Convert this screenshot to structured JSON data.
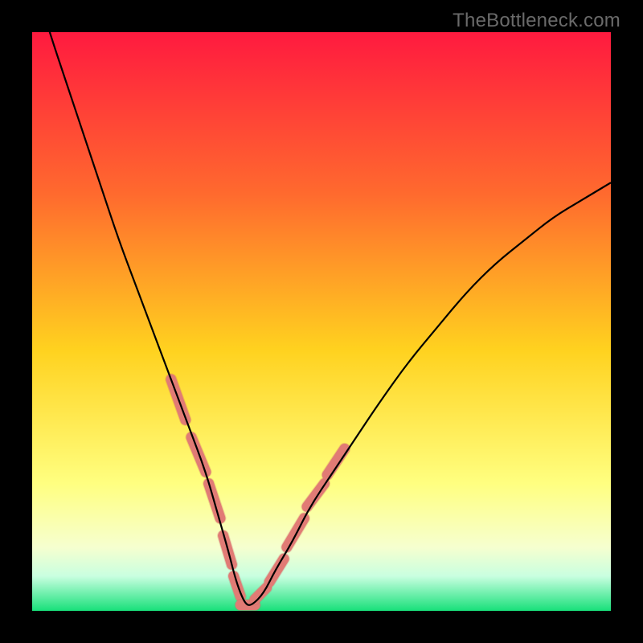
{
  "watermark": "TheBottleneck.com",
  "colors": {
    "frame": "#000000",
    "grad_top": "#ff1a3f",
    "grad_mid1": "#ff6a2e",
    "grad_mid2": "#ffd21f",
    "grad_mid3": "#ffff80",
    "grad_mid4": "#f6ffcf",
    "grad_bottom_pale": "#c9ffe0",
    "grad_bottom": "#18e07a",
    "curve": "#000000",
    "marker_fill": "#e17b75",
    "marker_stroke": "#c85f5a"
  },
  "chart_data": {
    "type": "line",
    "title": "",
    "xlabel": "",
    "ylabel": "",
    "xlim": [
      0,
      100
    ],
    "ylim": [
      0,
      100
    ],
    "series": [
      {
        "name": "bottleneck-curve",
        "x": [
          0,
          3,
          6,
          9,
          12,
          15,
          18,
          21,
          24,
          27,
          30,
          32,
          34,
          35,
          36,
          37,
          38,
          40,
          42,
          45,
          48,
          52,
          56,
          60,
          65,
          70,
          75,
          80,
          85,
          90,
          95,
          100
        ],
        "y": [
          110,
          100,
          91,
          82,
          73,
          64,
          56,
          48,
          40,
          32,
          24,
          17,
          10,
          6,
          3,
          1,
          1,
          3,
          7,
          12,
          18,
          24,
          30,
          36,
          43,
          49,
          55,
          60,
          64,
          68,
          71,
          74
        ]
      }
    ],
    "markers": {
      "name": "highlight-segments",
      "segments": [
        {
          "x": [
            24,
            26.5
          ],
          "y": [
            40,
            33
          ]
        },
        {
          "x": [
            27.5,
            30
          ],
          "y": [
            30,
            24
          ]
        },
        {
          "x": [
            30.5,
            32.5
          ],
          "y": [
            22,
            16
          ]
        },
        {
          "x": [
            33,
            34.5
          ],
          "y": [
            13,
            8
          ]
        },
        {
          "x": [
            34.8,
            36
          ],
          "y": [
            6,
            2.5
          ]
        },
        {
          "x": [
            36,
            38.5
          ],
          "y": [
            1,
            1
          ]
        },
        {
          "x": [
            38.5,
            40.5
          ],
          "y": [
            2,
            4
          ]
        },
        {
          "x": [
            41,
            43.5
          ],
          "y": [
            5,
            9
          ]
        },
        {
          "x": [
            44,
            47
          ],
          "y": [
            11,
            16
          ]
        },
        {
          "x": [
            47.5,
            50.5
          ],
          "y": [
            18,
            22
          ]
        },
        {
          "x": [
            51,
            54
          ],
          "y": [
            23.5,
            28
          ]
        }
      ]
    }
  }
}
